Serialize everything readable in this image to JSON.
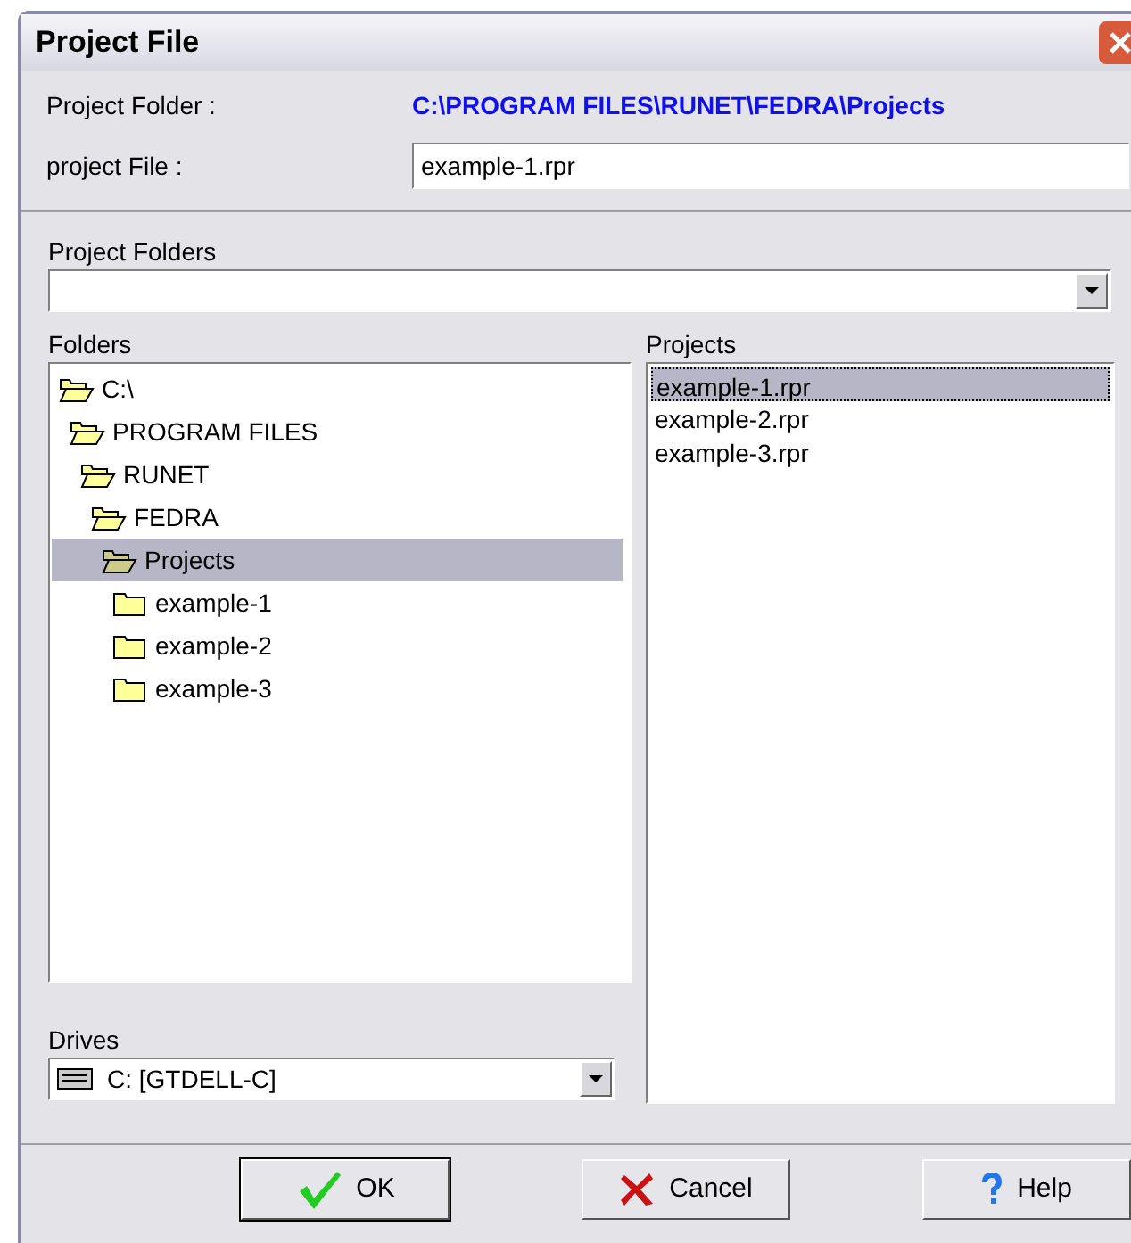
{
  "window": {
    "title": "Project File"
  },
  "project_folder": {
    "label": "Project Folder  :",
    "value": "C:\\PROGRAM FILES\\RUNET\\FEDRA\\Projects"
  },
  "project_file": {
    "label": "project File :",
    "value": "example-1.rpr"
  },
  "project_folders": {
    "label": "Project Folders"
  },
  "folders": {
    "label": "Folders",
    "tree": [
      {
        "name": "C:\\",
        "expanded": true,
        "selected": false,
        "children": [
          {
            "name": "PROGRAM FILES",
            "expanded": true,
            "selected": false,
            "children": [
              {
                "name": "RUNET",
                "expanded": true,
                "selected": false,
                "children": [
                  {
                    "name": "FEDRA",
                    "expanded": true,
                    "selected": false,
                    "children": [
                      {
                        "name": "Projects",
                        "expanded": true,
                        "selected": true,
                        "children": [
                          {
                            "name": "example-1",
                            "expanded": false,
                            "selected": false
                          },
                          {
                            "name": "example-2",
                            "expanded": false,
                            "selected": false
                          },
                          {
                            "name": "example-3",
                            "expanded": false,
                            "selected": false
                          }
                        ]
                      }
                    ]
                  }
                ]
              }
            ]
          }
        ]
      }
    ]
  },
  "drives": {
    "label": "Drives",
    "value": "C: [GTDELL-C]"
  },
  "projects": {
    "label": "Projects",
    "items": [
      {
        "name": "example-1.rpr",
        "selected": true
      },
      {
        "name": "example-2.rpr",
        "selected": false
      },
      {
        "name": "example-3.rpr",
        "selected": false
      }
    ]
  },
  "buttons": [
    {
      "kind": "ok",
      "label": "OK"
    },
    {
      "kind": "cancel",
      "label": "Cancel"
    },
    {
      "kind": "help",
      "label": "Help"
    }
  ]
}
